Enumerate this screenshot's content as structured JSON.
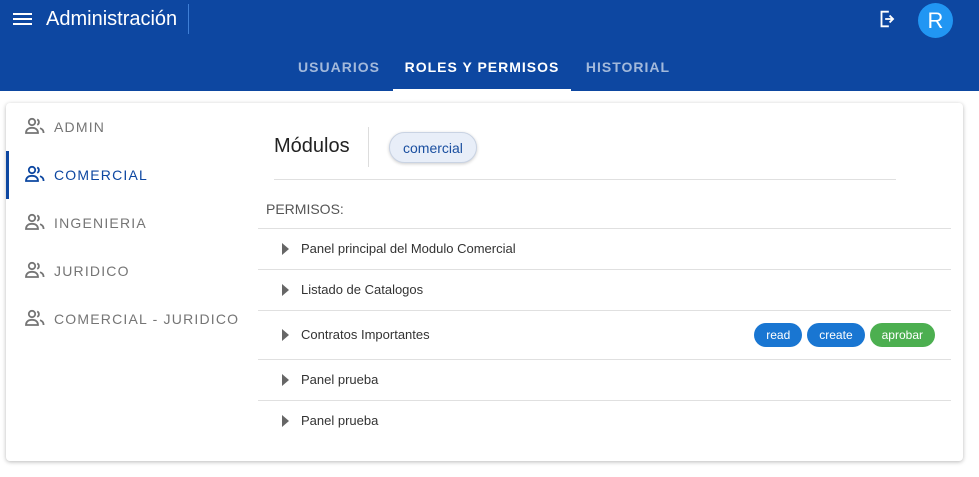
{
  "header": {
    "title": "Administración",
    "avatar_initial": "R"
  },
  "tabs": [
    {
      "label": "USUARIOS",
      "active": false
    },
    {
      "label": "ROLES Y PERMISOS",
      "active": true
    },
    {
      "label": "HISTORIAL",
      "active": false
    }
  ],
  "roles": [
    {
      "label": "ADMIN",
      "active": false
    },
    {
      "label": "COMERCIAL",
      "active": true
    },
    {
      "label": "INGENIERIA",
      "active": false
    },
    {
      "label": "JURIDICO",
      "active": false
    },
    {
      "label": "COMERCIAL - JURIDICO",
      "active": false
    }
  ],
  "modules": {
    "label": "Módulos",
    "selected": "comercial"
  },
  "permisos": {
    "label": "PERMISOS:",
    "items": [
      {
        "label": "Panel principal del Modulo Comercial",
        "badges": []
      },
      {
        "label": "Listado de Catalogos",
        "badges": []
      },
      {
        "label": "Contratos Importantes",
        "badges": [
          {
            "label": "read",
            "color": "#1976d2"
          },
          {
            "label": "create",
            "color": "#1976d2"
          },
          {
            "label": "aprobar",
            "color": "#4caf50"
          }
        ]
      },
      {
        "label": "Panel prueba",
        "badges": []
      },
      {
        "label": "Panel prueba",
        "badges": []
      }
    ]
  },
  "colors": {
    "primary": "#0d47a1",
    "avatar": "#2196f3",
    "badge_blue": "#1976d2",
    "badge_green": "#4caf50"
  }
}
